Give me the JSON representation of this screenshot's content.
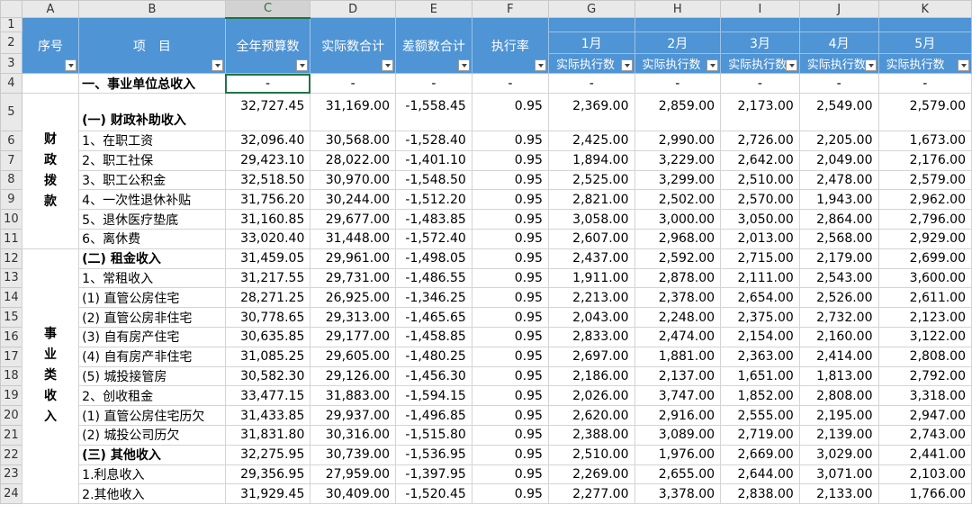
{
  "columns": [
    "A",
    "B",
    "C",
    "D",
    "E",
    "F",
    "G",
    "H",
    "I",
    "J",
    "K"
  ],
  "header": {
    "seq": "序号",
    "item": "项　目",
    "budget": "全年预算数",
    "actual": "实际数合计",
    "diff": "差额数合计",
    "rate": "执行率",
    "months": [
      "1月",
      "2月",
      "3月",
      "4月",
      "5月"
    ],
    "sub_label": "实际执行数"
  },
  "categories": {
    "fiscal": "财\n政\n拨\n款",
    "business": "事\n业\n类\n收\n入"
  },
  "rows": [
    {
      "n": "4",
      "item": "一、事业单位总收入",
      "bold": true,
      "vals": [
        "-",
        "-",
        "-",
        "-",
        "-",
        "-",
        "-",
        "-",
        "-"
      ]
    },
    {
      "n": "5",
      "item": "(一) 财政补助收入",
      "bold": true,
      "vals": [
        "32,727.45",
        "31,169.00",
        "-1,558.45",
        "0.95",
        "2,369.00",
        "2,859.00",
        "2,173.00",
        "2,549.00",
        "2,579.00"
      ]
    },
    {
      "n": "6",
      "item": "1、在职工资",
      "vals": [
        "32,096.40",
        "30,568.00",
        "-1,528.40",
        "0.95",
        "2,425.00",
        "2,990.00",
        "2,726.00",
        "2,205.00",
        "1,673.00"
      ]
    },
    {
      "n": "7",
      "item": "2、职工社保",
      "vals": [
        "29,423.10",
        "28,022.00",
        "-1,401.10",
        "0.95",
        "1,894.00",
        "3,229.00",
        "2,642.00",
        "2,049.00",
        "2,176.00"
      ]
    },
    {
      "n": "8",
      "item": "3、职工公积金",
      "vals": [
        "32,518.50",
        "30,970.00",
        "-1,548.50",
        "0.95",
        "2,525.00",
        "3,299.00",
        "2,510.00",
        "2,478.00",
        "2,579.00"
      ]
    },
    {
      "n": "9",
      "item": "4、一次性退休补贴",
      "vals": [
        "31,756.20",
        "30,244.00",
        "-1,512.20",
        "0.95",
        "2,821.00",
        "2,502.00",
        "2,570.00",
        "1,943.00",
        "2,962.00"
      ]
    },
    {
      "n": "10",
      "item": "5、退休医疗垫底",
      "vals": [
        "31,160.85",
        "29,677.00",
        "-1,483.85",
        "0.95",
        "3,058.00",
        "3,000.00",
        "3,050.00",
        "2,864.00",
        "2,796.00"
      ]
    },
    {
      "n": "11",
      "item": "6、离休费",
      "vals": [
        "33,020.40",
        "31,448.00",
        "-1,572.40",
        "0.95",
        "2,607.00",
        "2,968.00",
        "2,013.00",
        "2,568.00",
        "2,929.00"
      ]
    },
    {
      "n": "12",
      "item": "(二) 租金收入",
      "bold": true,
      "vals": [
        "31,459.05",
        "29,961.00",
        "-1,498.05",
        "0.95",
        "2,437.00",
        "2,592.00",
        "2,715.00",
        "2,179.00",
        "2,699.00"
      ]
    },
    {
      "n": "13",
      "item": "1、常租收入",
      "vals": [
        "31,217.55",
        "29,731.00",
        "-1,486.55",
        "0.95",
        "1,911.00",
        "2,878.00",
        "2,111.00",
        "2,543.00",
        "3,600.00"
      ]
    },
    {
      "n": "14",
      "item": "(1) 直管公房住宅",
      "vals": [
        "28,271.25",
        "26,925.00",
        "-1,346.25",
        "0.95",
        "2,213.00",
        "2,378.00",
        "2,654.00",
        "2,526.00",
        "2,611.00"
      ]
    },
    {
      "n": "15",
      "item": "(2) 直管公房非住宅",
      "vals": [
        "30,778.65",
        "29,313.00",
        "-1,465.65",
        "0.95",
        "2,043.00",
        "2,248.00",
        "2,375.00",
        "2,732.00",
        "2,123.00"
      ]
    },
    {
      "n": "16",
      "item": "(3) 自有房产住宅",
      "vals": [
        "30,635.85",
        "29,177.00",
        "-1,458.85",
        "0.95",
        "2,833.00",
        "2,474.00",
        "2,154.00",
        "2,160.00",
        "3,122.00"
      ]
    },
    {
      "n": "17",
      "item": "(4) 自有房产非住宅",
      "vals": [
        "31,085.25",
        "29,605.00",
        "-1,480.25",
        "0.95",
        "2,697.00",
        "1,881.00",
        "2,363.00",
        "2,414.00",
        "2,808.00"
      ]
    },
    {
      "n": "18",
      "item": "(5) 城投接管房",
      "vals": [
        "30,582.30",
        "29,126.00",
        "-1,456.30",
        "0.95",
        "2,186.00",
        "2,137.00",
        "1,651.00",
        "1,813.00",
        "2,792.00"
      ]
    },
    {
      "n": "19",
      "item": "2、创收租金",
      "vals": [
        "33,477.15",
        "31,883.00",
        "-1,594.15",
        "0.95",
        "2,026.00",
        "3,747.00",
        "1,852.00",
        "2,808.00",
        "3,318.00"
      ]
    },
    {
      "n": "20",
      "item": "(1) 直管公房住宅历欠",
      "vals": [
        "31,433.85",
        "29,937.00",
        "-1,496.85",
        "0.95",
        "2,620.00",
        "2,916.00",
        "2,555.00",
        "2,195.00",
        "2,947.00"
      ]
    },
    {
      "n": "21",
      "item": "(2) 城投公司历欠",
      "vals": [
        "31,831.80",
        "30,316.00",
        "-1,515.80",
        "0.95",
        "2,388.00",
        "3,089.00",
        "2,719.00",
        "2,139.00",
        "2,743.00"
      ]
    },
    {
      "n": "22",
      "item": "(三) 其他收入",
      "bold": true,
      "vals": [
        "32,275.95",
        "30,739.00",
        "-1,536.95",
        "0.95",
        "2,510.00",
        "1,976.00",
        "2,669.00",
        "3,029.00",
        "2,441.00"
      ]
    },
    {
      "n": "23",
      "item": "1.利息收入",
      "vals": [
        "29,356.95",
        "27,959.00",
        "-1,397.95",
        "0.95",
        "2,269.00",
        "2,655.00",
        "2,644.00",
        "3,071.00",
        "2,103.00"
      ]
    },
    {
      "n": "24",
      "item": "2.其他收入",
      "vals": [
        "31,929.45",
        "30,409.00",
        "-1,520.45",
        "0.95",
        "2,277.00",
        "3,378.00",
        "2,838.00",
        "2,133.00",
        "1,766.00"
      ]
    }
  ]
}
